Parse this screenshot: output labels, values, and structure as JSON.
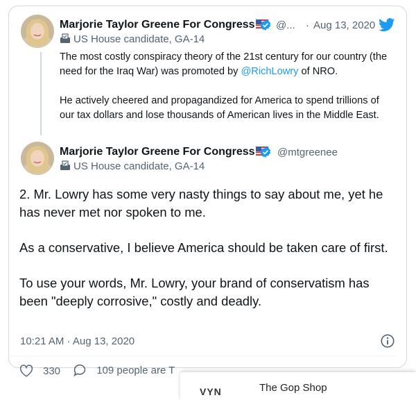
{
  "quoted_tweet": {
    "author_name": "Marjorie Taylor Greene For Congress",
    "handle": "@...",
    "separator": "·",
    "date": "Aug 13, 2020",
    "subtitle": "US House candidate, GA-14",
    "paragraph1_before": "The most costly conspiracy theory of the 21st century for our country (the need for the Iraq War) was promoted by ",
    "mention": "@RichLowry",
    "paragraph1_after": " of NRO.",
    "paragraph2": "He actively cheered and propagandized for America to spend trillions of our tax dollars and lose thousands of American lives in the Middle East."
  },
  "main_tweet": {
    "author_name": "Marjorie Taylor Greene For Congress",
    "handle": "@mtgreenee",
    "subtitle": "US House candidate, GA-14",
    "paragraphs": [
      "2. Mr. Lowry has some very nasty things to say about me, yet he has never met nor spoken to me.",
      "As a conservative, I believe America should be taken care of first.",
      "To use your words, Mr. Lowry, your brand of conservatism has been \"deeply corrosive,\" costly and deadly."
    ],
    "timestamp": "10:21 AM · Aug 13, 2020"
  },
  "stats": {
    "likes": "330",
    "talking": "109 people are T"
  },
  "popup": {
    "brand": "VYN",
    "title": "The Gop Shop"
  },
  "colors": {
    "link": "#1d9bf0",
    "verified": "#1d9bf0",
    "twitter": "#1d9bf0",
    "secondary_text": "#536471"
  },
  "icons": [
    "twitter-bird-icon",
    "verified-badge-icon",
    "us-flag-icon",
    "ballot-box-icon",
    "info-icon",
    "heart-icon",
    "comment-icon"
  ]
}
